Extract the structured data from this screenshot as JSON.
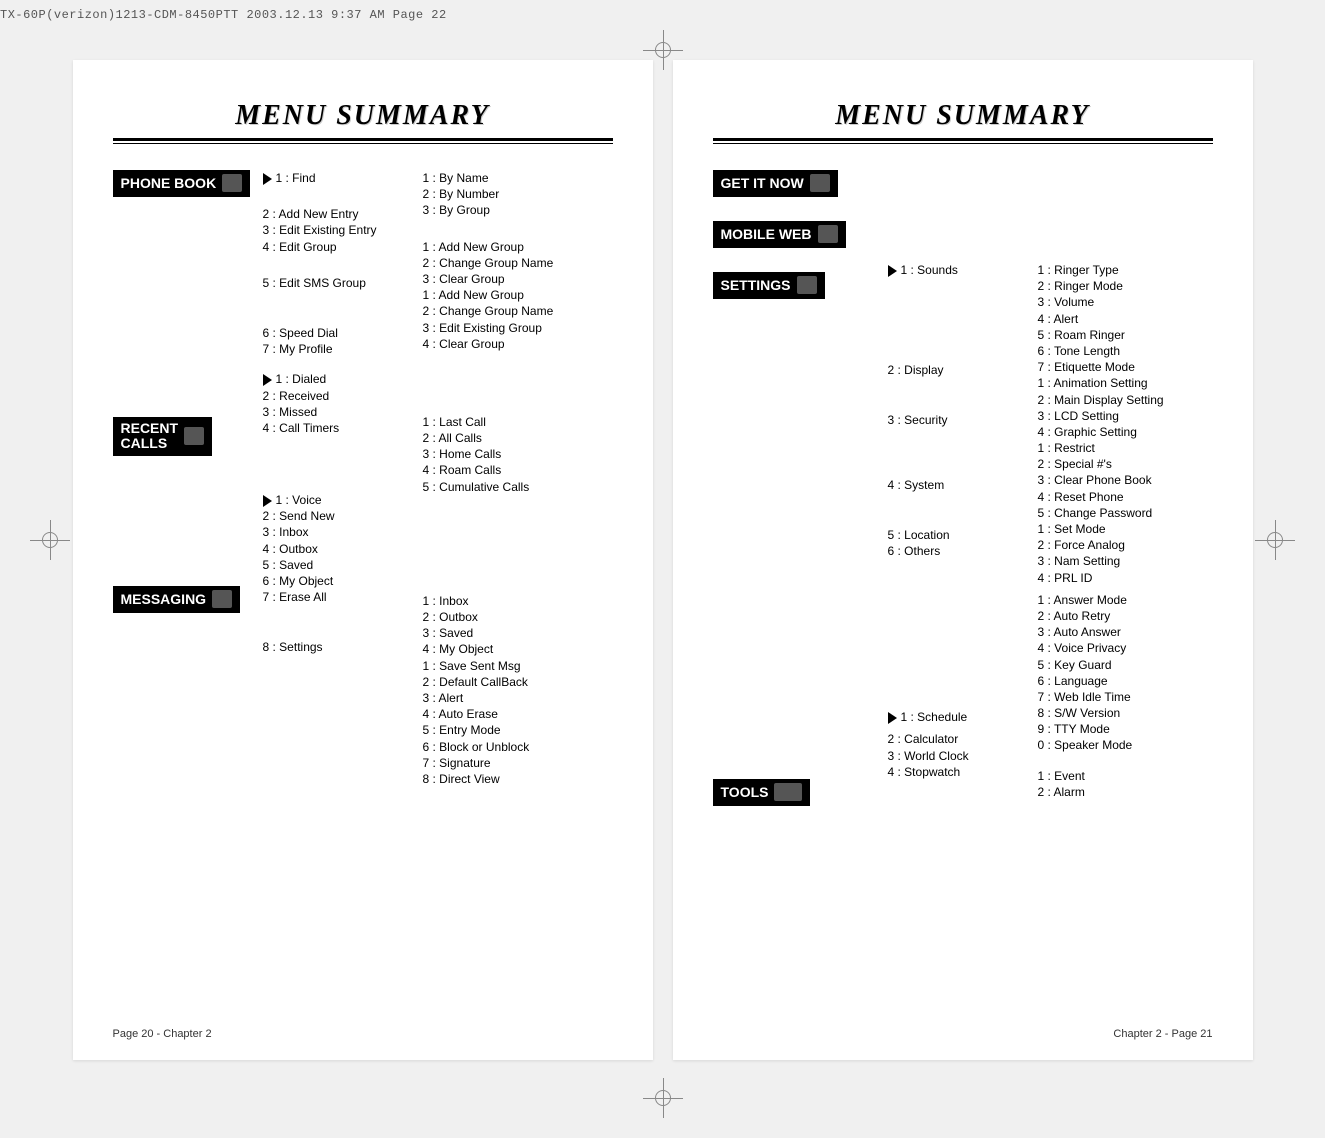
{
  "topline": "TX-60P(verizon)1213-CDM-8450PTT  2003.12.13  9:37 AM  Page 22",
  "title": "MENU SUMMARY",
  "sections": {
    "phone_book": {
      "label": "PHONE BOOK",
      "items": {
        "i1": "1 : Find",
        "i1_sub": {
          "a": "1 : By Name",
          "b": "2 : By Number",
          "c": "3 : By Group"
        },
        "i2": "2 : Add New Entry",
        "i3": "3 : Edit Existing Entry",
        "i4": "4 : Edit Group",
        "i4_sub": {
          "a": "1 : Add New Group",
          "b": "2 : Change Group Name",
          "c": "3 : Clear Group"
        },
        "i5": "5 : Edit SMS Group",
        "i5_sub": {
          "a": "1 : Add New Group",
          "b": "2 : Change Group Name",
          "c": "3 : Edit Existing Group",
          "d": "4 : Clear Group"
        },
        "i6": "6 : Speed Dial",
        "i7": "7 : My Profile"
      }
    },
    "recent_calls": {
      "label": "RECENT CALLS",
      "items": {
        "i1": "1 : Dialed",
        "i2": "2 : Received",
        "i3": "3 : Missed",
        "i4": "4 : Call Timers",
        "i4_sub": {
          "a": "1 : Last Call",
          "b": "2 : All Calls",
          "c": "3 : Home Calls",
          "d": "4 : Roam Calls",
          "e": "5 : Cumulative Calls"
        }
      }
    },
    "messaging": {
      "label": "MESSAGING",
      "items": {
        "i1": "1 : Voice",
        "i2": "2 : Send New",
        "i3": "3 : Inbox",
        "i4": "4 : Outbox",
        "i5": "5 : Saved",
        "i6": "6 : My Object",
        "i7": "7 : Erase All",
        "i7_sub": {
          "a": "1 : Inbox",
          "b": "2 : Outbox",
          "c": "3 : Saved",
          "d": "4 : My Object"
        },
        "i8": "8 : Settings",
        "i8_sub": {
          "a": "1 : Save Sent Msg",
          "b": "2 : Default CallBack",
          "c": "3 : Alert",
          "d": "4 : Auto Erase",
          "e": "5 : Entry Mode",
          "f": "6 : Block or Unblock",
          "g": "7 : Signature",
          "h": "8 : Direct View"
        }
      }
    },
    "get_it_now": {
      "label": "GET IT NOW"
    },
    "mobile_web": {
      "label": "MOBILE WEB"
    },
    "settings": {
      "label": "SETTINGS",
      "items": {
        "i1": "1 : Sounds",
        "i1_sub": {
          "a": "1 : Ringer Type",
          "b": "2 : Ringer Mode",
          "c": "3 : Volume",
          "d": "4 : Alert",
          "e": "5 : Roam Ringer",
          "f": "6 : Tone Length",
          "g": "7 : Etiquette Mode"
        },
        "i2": "2 : Display",
        "i2_sub": {
          "a": "1 : Animation Setting",
          "b": "2 : Main Display Setting",
          "c": "3 : LCD Setting",
          "d": "4 : Graphic Setting"
        },
        "i3": "3 : Security",
        "i3_sub": {
          "a": "1 : Restrict",
          "b": "2 : Special #'s",
          "c": "3 : Clear Phone Book",
          "d": "4 : Reset Phone",
          "e": "5 : Change Password"
        },
        "i4": "4 : System",
        "i4_sub": {
          "a": "1 : Set Mode",
          "b": "2 : Force Analog",
          "c": "3 : Nam Setting",
          "d": "4 : PRL ID"
        },
        "i5": "5 : Location",
        "i6": "6 : Others",
        "i6_sub": {
          "a": "1 : Answer Mode",
          "b": "2 : Auto Retry",
          "c": "3 : Auto Answer",
          "d": "4 : Voice Privacy",
          "e": "5 : Key Guard",
          "f": "6 : Language",
          "g": "7 : Web Idle Time",
          "h": "8 : S/W Version",
          "i": "9 : TTY Mode",
          "j": "0 : Speaker Mode"
        }
      }
    },
    "tools": {
      "label": "TOOLS",
      "items": {
        "i1": "1 : Schedule",
        "i1_sub": {
          "a": "1 : Event",
          "b": "2 : Alarm"
        },
        "i2": "2 : Calculator",
        "i3": "3 : World Clock",
        "i4": "4 : Stopwatch"
      }
    }
  },
  "footer_left": "Page 20 - Chapter 2",
  "footer_right": "Chapter 2 - Page 21"
}
